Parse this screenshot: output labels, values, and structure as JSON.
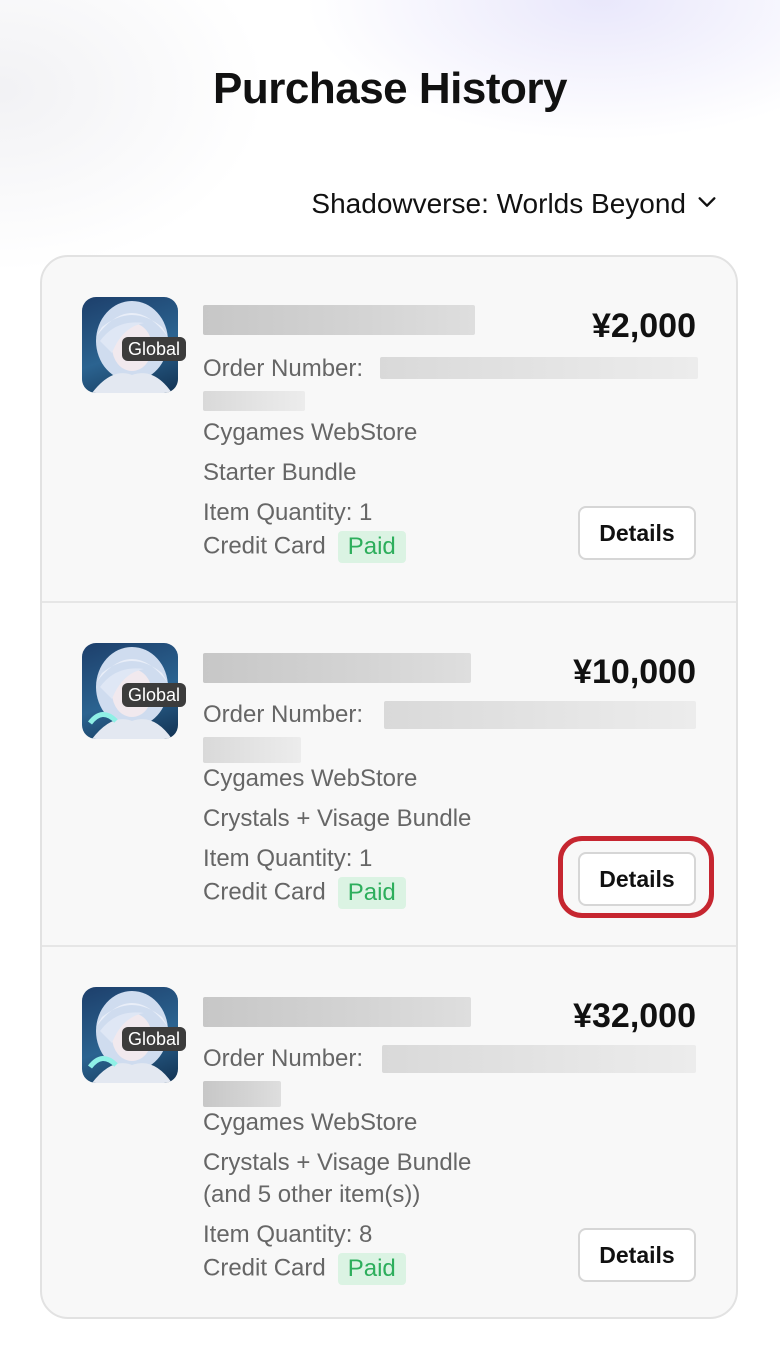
{
  "page": {
    "title": "Purchase History"
  },
  "game_selector": {
    "label": "Shadowverse: Worlds Beyond",
    "icon": "chevron-down-icon"
  },
  "orders": [
    {
      "price": "¥2,000",
      "order_number_label": "Order Number:",
      "store": "Cygames WebStore",
      "item": "Starter Bundle",
      "item_extra": "",
      "quantity": "Item Quantity: 1",
      "payment_method": "Credit Card",
      "status": "Paid",
      "region": "Global",
      "details_label": "Details"
    },
    {
      "price": "¥10,000",
      "order_number_label": "Order Number:",
      "store": "Cygames WebStore",
      "item": "Crystals + Visage Bundle",
      "item_extra": "",
      "quantity": "Item Quantity: 1",
      "payment_method": "Credit Card",
      "status": "Paid",
      "region": "Global",
      "details_label": "Details"
    },
    {
      "price": "¥32,000",
      "order_number_label": "Order Number:",
      "store": "Cygames WebStore",
      "item": "Crystals + Visage Bundle",
      "item_extra": "(and 5 other item(s))",
      "quantity": "Item Quantity: 8",
      "payment_method": "Credit Card",
      "status": "Paid",
      "region": "Global",
      "details_label": "Details"
    }
  ],
  "colors": {
    "status_paid_bg": "#dbf3e3",
    "status_paid_text": "#2dae5c",
    "highlight": "#c62630"
  }
}
